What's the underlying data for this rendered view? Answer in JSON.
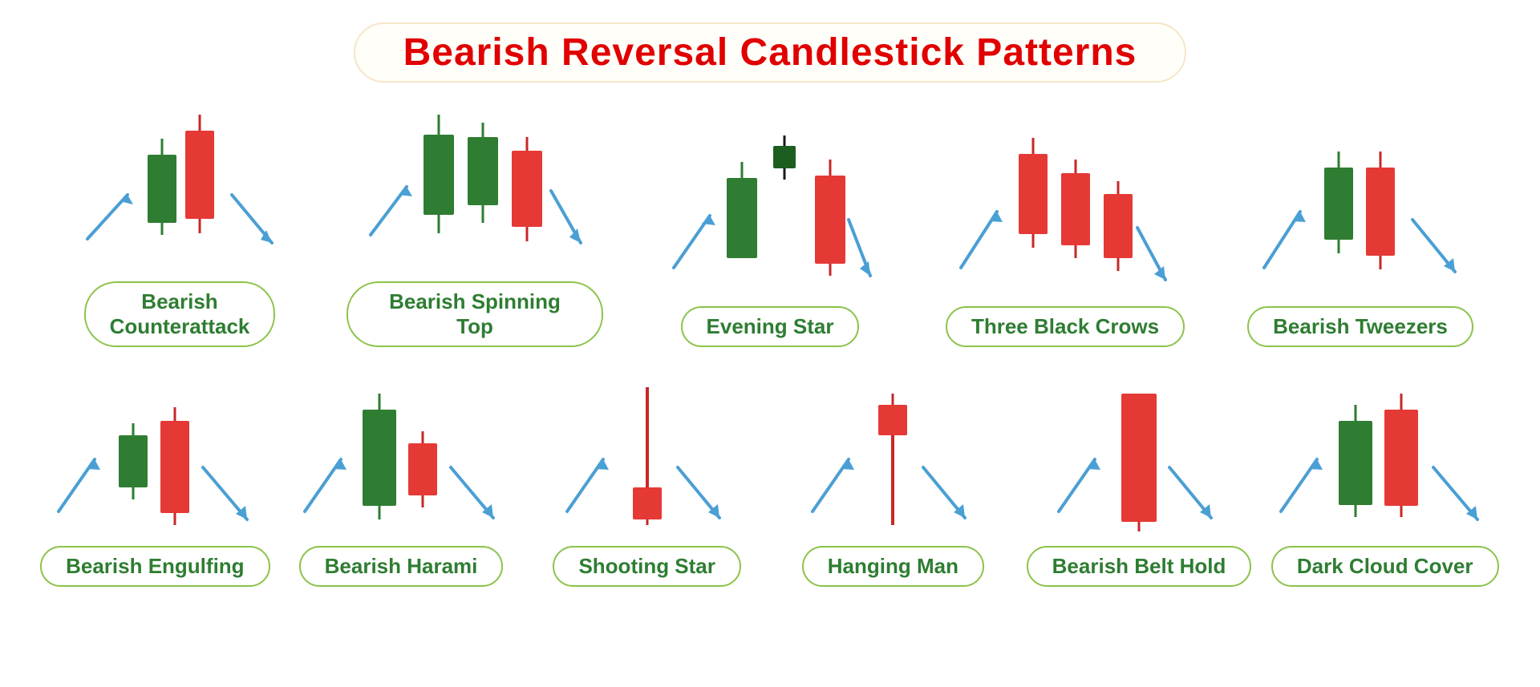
{
  "title": "Bearish Reversal Candlestick Patterns",
  "patterns": [
    {
      "id": "bearish-counterattack",
      "label": "Bearish\nCounterattack",
      "row": 0
    },
    {
      "id": "bearish-spinning-top",
      "label": "Bearish Spinning Top",
      "row": 0
    },
    {
      "id": "evening-star",
      "label": "Evening Star",
      "row": 0
    },
    {
      "id": "three-black-crows",
      "label": "Three Black Crows",
      "row": 0
    },
    {
      "id": "bearish-tweezers",
      "label": "Bearish Tweezers",
      "row": 0
    },
    {
      "id": "bearish-engulfing",
      "label": "Bearish Engulfing",
      "row": 1
    },
    {
      "id": "bearish-harami",
      "label": "Bearish Harami",
      "row": 1
    },
    {
      "id": "shooting-star",
      "label": "Shooting Star",
      "row": 1
    },
    {
      "id": "hanging-man",
      "label": "Hanging Man",
      "row": 1
    },
    {
      "id": "bearish-belt-hold",
      "label": "Bearish Belt Hold",
      "row": 1
    },
    {
      "id": "dark-cloud-cover",
      "label": "Dark Cloud Cover",
      "row": 1
    }
  ]
}
